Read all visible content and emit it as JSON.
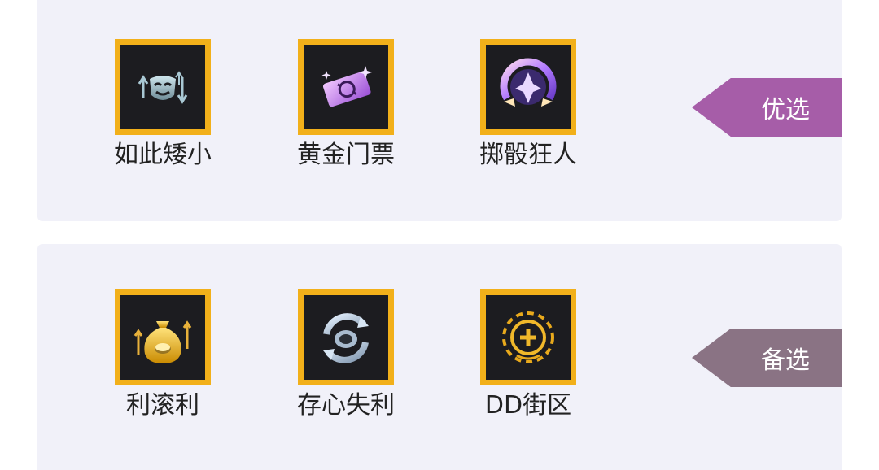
{
  "sections": [
    {
      "tag": {
        "label": "优选",
        "color": "#a65da8"
      },
      "items": [
        {
          "label": "如此矮小",
          "icon": "tiny-mask-icon"
        },
        {
          "label": "黄金门票",
          "icon": "golden-ticket-icon"
        },
        {
          "label": "掷骰狂人",
          "icon": "dice-maniac-icon"
        }
      ]
    },
    {
      "tag": {
        "label": "备选",
        "color": "#8a7384"
      },
      "items": [
        {
          "label": "利滚利",
          "icon": "money-bag-icon"
        },
        {
          "label": "存心失利",
          "icon": "coin-cycle-icon"
        },
        {
          "label": "DD街区",
          "icon": "dd-chip-icon"
        }
      ]
    }
  ]
}
